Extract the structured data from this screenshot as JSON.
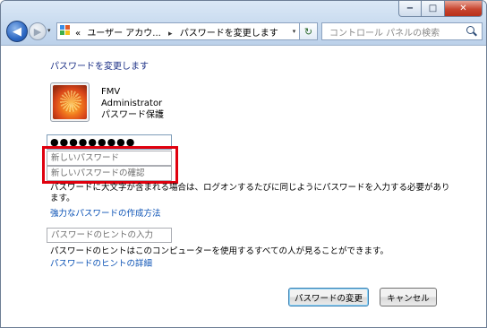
{
  "window": {
    "caption": {
      "minimize": "−",
      "maximize": "□",
      "close": "✕"
    }
  },
  "nav": {
    "back_glyph": "◀",
    "forward_glyph": "▶",
    "dropdown_glyph": "▾",
    "address": {
      "overflow": "«",
      "crumb1": "ユーザー アカウ...",
      "separator": "▸",
      "crumb2": "パスワードを変更します",
      "dropdown_glyph": "▾"
    },
    "refresh_glyph": "↻",
    "search": {
      "placeholder": "コントロール パネルの検索"
    }
  },
  "main": {
    "heading": "パスワードを変更します",
    "user": {
      "name": "FMV",
      "role": "Administrator",
      "protection": "パスワード保護"
    },
    "current_password": "●●●●●●●●●",
    "new_password_placeholder": "新しいパスワード",
    "confirm_password_placeholder": "新しいパスワードの確認",
    "warning": "パスワードに大文字が含まれる場合は、ログオンするたびに同じようにパスワードを入力する必要があります。",
    "strong_password_link": "強力なパスワードの作成方法",
    "hint_placeholder": "パスワードのヒントの入力",
    "hint_note": "パスワードのヒントはこのコンピューターを使用するすべての人が見ることができます。",
    "hint_link": "パスワードのヒントの詳細"
  },
  "buttons": {
    "change": "パスワードの変更",
    "cancel": "キャンセル"
  },
  "colors": {
    "highlight": "#e0000e",
    "link": "#0b52b5",
    "heading": "#1e3287"
  }
}
